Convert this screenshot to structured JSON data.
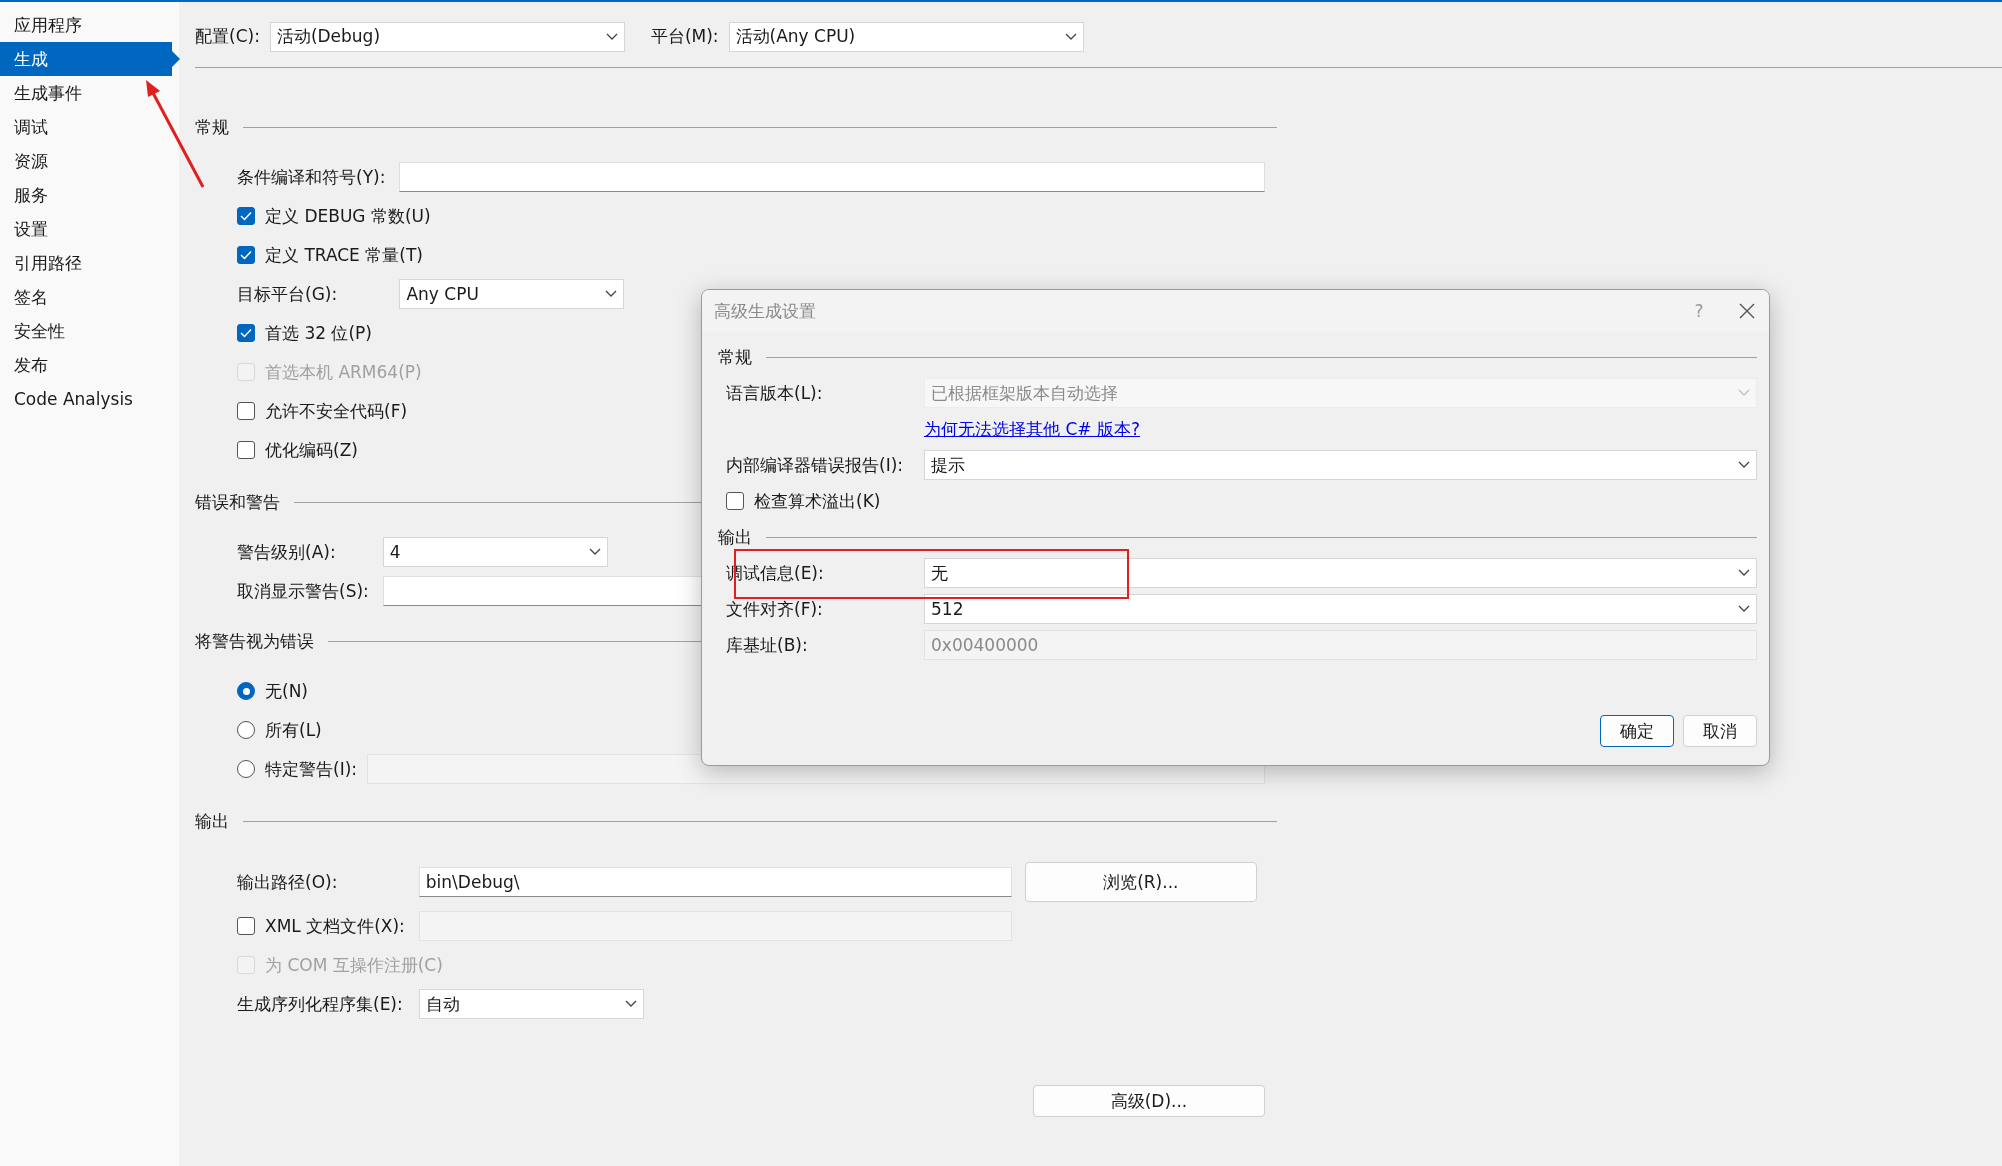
{
  "sidebar": {
    "items": [
      {
        "label": "应用程序",
        "selected": false
      },
      {
        "label": "生成",
        "selected": true
      },
      {
        "label": "生成事件",
        "selected": false
      },
      {
        "label": "调试",
        "selected": false
      },
      {
        "label": "资源",
        "selected": false
      },
      {
        "label": "服务",
        "selected": false
      },
      {
        "label": "设置",
        "selected": false
      },
      {
        "label": "引用路径",
        "selected": false
      },
      {
        "label": "签名",
        "selected": false
      },
      {
        "label": "安全性",
        "selected": false
      },
      {
        "label": "发布",
        "selected": false
      },
      {
        "label": "Code Analysis",
        "selected": false
      }
    ]
  },
  "toolbar": {
    "fields": [
      {
        "label": "配置(C):",
        "value": "活动(Debug)"
      },
      {
        "label": "平台(M):",
        "value": "活动(Any CPU)"
      }
    ]
  },
  "sections": [
    {
      "title": "常规",
      "rows": [
        {
          "kind": "text",
          "label": "条件编译和符号(Y):",
          "disabled": false
        },
        {
          "kind": "checkbox",
          "label": "定义 DEBUG 常数(U)",
          "checked": true,
          "disabled": false
        },
        {
          "kind": "checkbox",
          "label": "定义 TRACE 常量(T)",
          "checked": true,
          "disabled": false
        },
        {
          "kind": "dropdown",
          "label": "目标平台(G):",
          "value": "Any CPU",
          "disabled": false
        },
        {
          "kind": "checkbox",
          "label": "首选 32 位(P)",
          "checked": true,
          "disabled": false
        },
        {
          "kind": "checkbox",
          "label": "首选本机 ARM64(P)",
          "checked": false,
          "disabled": true
        },
        {
          "kind": "checkbox",
          "label": "允许不安全代码(F)",
          "checked": false,
          "disabled": false
        },
        {
          "kind": "checkbox",
          "label": "优化编码(Z)",
          "checked": false,
          "disabled": false
        }
      ]
    },
    {
      "title": "错误和警告",
      "rows": [
        {
          "kind": "dropdown",
          "label": "警告级别(A):",
          "value": "4",
          "disabled": false
        },
        {
          "kind": "text",
          "label": "取消显示警告(S):",
          "disabled": false
        }
      ]
    },
    {
      "title": "将警告视为错误",
      "rows": [
        {
          "kind": "radio",
          "label": "无(N)",
          "selected": true
        },
        {
          "kind": "radio",
          "label": "所有(L)",
          "selected": false
        },
        {
          "kind": "radio_field",
          "label": "特定警告(I):",
          "selected": false,
          "disabled": true
        }
      ]
    },
    {
      "title": "输出",
      "rows": [
        {
          "kind": "path",
          "label": "输出路径(O):",
          "value": "bin\\Debug\\",
          "button": "浏览(R)..."
        },
        {
          "kind": "checkbox_field",
          "label": "XML 文档文件(X):",
          "checked": false,
          "disabled": true
        },
        {
          "kind": "checkbox",
          "label": "为 COM 互操作注册(C)",
          "checked": false,
          "disabled": true
        },
        {
          "kind": "dropdown",
          "label": "生成序列化程序集(E):",
          "value": "自动",
          "disabled": false
        }
      ]
    }
  ],
  "advanced_button": "高级(D)...",
  "dialog": {
    "title": "高级生成设置",
    "help": "?",
    "sections": [
      {
        "title": "常规",
        "rows": [
          {
            "kind": "dropdown",
            "label": "语言版本(L):",
            "value": "已根据框架版本自动选择",
            "disabled": true
          },
          {
            "kind": "link",
            "text": "为何无法选择其他 C# 版本?"
          },
          {
            "kind": "dropdown",
            "label": "内部编译器错误报告(I):",
            "value": "提示",
            "disabled": false
          },
          {
            "kind": "checkbox",
            "label": "检查算术溢出(K)",
            "checked": false,
            "disabled": false
          }
        ]
      },
      {
        "title": "输出",
        "rows": [
          {
            "kind": "dropdown",
            "label": "调试信息(E):",
            "value": "无",
            "disabled": false
          },
          {
            "kind": "dropdown",
            "label": "文件对齐(F):",
            "value": "512",
            "disabled": false
          },
          {
            "kind": "text",
            "label": "库基址(B):",
            "value": "0x00400000",
            "disabled": true
          }
        ]
      }
    ],
    "buttons": [
      {
        "label": "确定",
        "default": true
      },
      {
        "label": "取消",
        "default": false
      }
    ]
  }
}
